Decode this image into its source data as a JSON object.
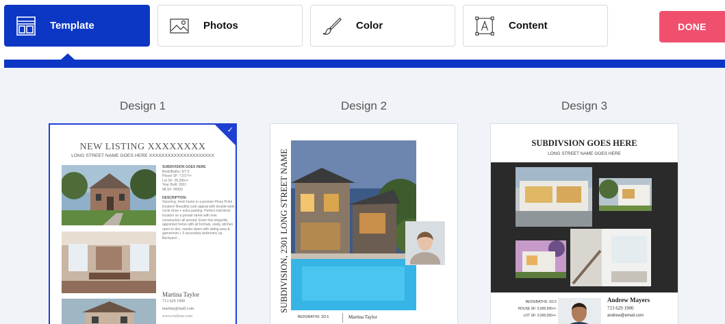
{
  "toolbar": {
    "template_label": "Template",
    "photos_label": "Photos",
    "color_label": "Color",
    "content_label": "Content",
    "done_label": "DONE"
  },
  "designs": [
    {
      "title": "Design 1",
      "selected": true,
      "listing_title": "NEW LISTING XXXXXXXX",
      "street": "LONG STREET NAME GOES HERE XXXXXXXXXXXXXXXXXXXXX",
      "subdivision": "SUBDIVISION GOES HERE",
      "details": [
        "Beds/Baths: 6/7.5",
        "House SF: 7,017+/-",
        "Lot SF: 28,399+/-",
        "Year Built: 2001",
        "MLS#: 00000"
      ],
      "description_label": "DESCRIPTION:",
      "description": "Stunning, fresh home in a premier Piney Point location! Beautiful curb appeal with double-wide circle drive + extra parking. Perfect mid-block location on a private street with new construction all around. Enter this elegantly appointed home with all formals, study, kitchen open to den, master down with sitting area & gameroom + 5 secondary bedrooms up. Backyard ...",
      "agent_name": "Martina Taylor",
      "agent_phone": "713 629 1900",
      "agent_email": "martina@mail.com",
      "agent_web": "www.realtors.com"
    },
    {
      "title": "Design 2",
      "vertical_text": "SUBDIVISION, 2301 LONG STREET NAME",
      "beds_baths": "BEDS/BATHS: 3/3.5",
      "agent_name": "Martina Taylor"
    },
    {
      "title": "Design 3",
      "heading": "SUBDIVSION GOES HERE",
      "street": "LONG STREET NAME GOES HERE",
      "stats": [
        "BEDS/BATHS: 3/3.5",
        "HOUSE SF: 0,000,000+/-",
        "LOT SF: 0,000,000+/-"
      ],
      "agent_name": "Andrew Mayers",
      "agent_phone": "713 629 1900",
      "agent_email": "andrew@email.com"
    }
  ],
  "colors": {
    "accent": "#0c37c5",
    "done": "#f0506e",
    "panel": "#f0f4f8"
  }
}
